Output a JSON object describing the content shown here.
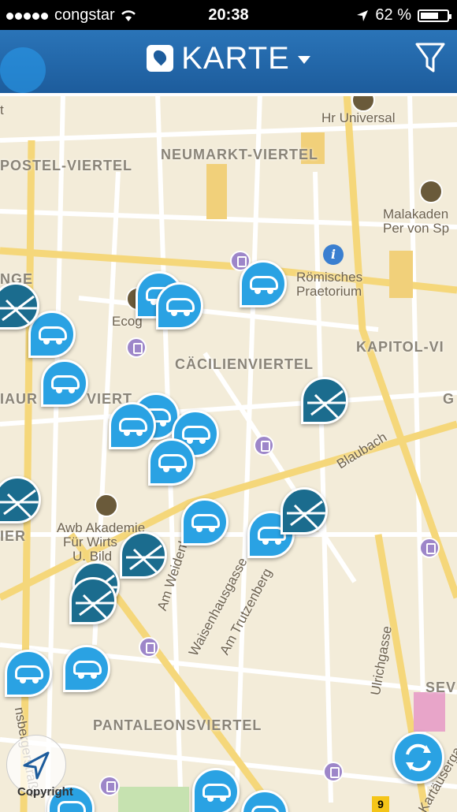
{
  "status_bar": {
    "carrier": "congstar",
    "time": "20:38",
    "battery": "62 %",
    "battery_level": 0.62
  },
  "header": {
    "title": "KARTE",
    "menu_icon": "map-icon",
    "filter_icon": "filter-icon"
  },
  "map": {
    "district_labels": [
      "POSTEL-VIERTEL",
      "NEUMARKT-VIERTEL",
      "CÄCILIENVIERTEL",
      "KAPITOL-VI",
      "PANTALEONSVIERTEL",
      "NGE",
      "IAUR",
      "VIERT",
      "IER",
      "SEV",
      "G"
    ],
    "street_labels": [
      "Blaubach",
      "Am Weidenb",
      "Waisenhausgasse",
      "Am Trutzenberg",
      "Ulrichgasse",
      "nsbergerstraße",
      "Kartäusergasse"
    ],
    "poi_labels": [
      "Hr Universal",
      "Malakaden",
      "Per von Sp",
      "Römisches",
      "Praetorium",
      "Ecog",
      "Awb Akademie",
      "Für Wirts",
      "U. Bild",
      "t"
    ],
    "copyright": "Copyright",
    "route_shield": "9"
  },
  "colors": {
    "car_pin": "#2aa2e3",
    "zone_pin": "#1b6c8e",
    "header": "#1d5c9c",
    "tram": "#9d86c9"
  }
}
